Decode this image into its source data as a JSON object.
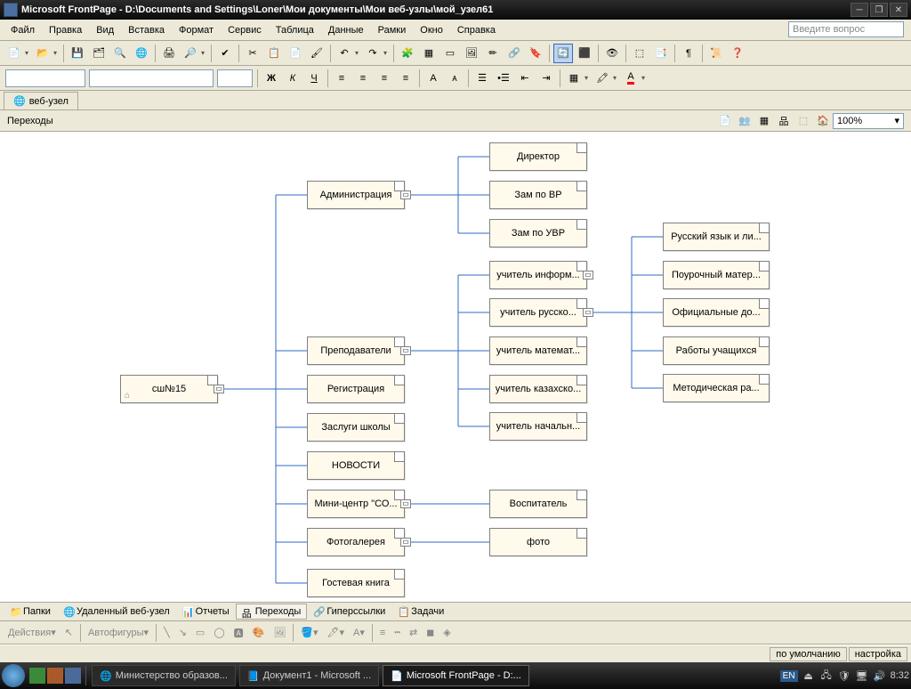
{
  "titlebar": {
    "app": "Microsoft FrontPage",
    "path": "D:\\Documents and Settings\\Loner\\Мои документы\\Мои веб-узлы\\мой_узел61"
  },
  "menus": [
    "Файл",
    "Правка",
    "Вид",
    "Вставка",
    "Формат",
    "Сервис",
    "Таблица",
    "Данные",
    "Рамки",
    "Окно",
    "Справка"
  ],
  "question_prompt": "Введите вопрос",
  "doc_tab": "веб-узел",
  "subheader_label": "Переходы",
  "zoom": "100%",
  "diagram": {
    "root": "сш№15",
    "level2": [
      "Администрация",
      "Преподаватели",
      "Регистрация",
      "Заслуги школы",
      "НОВОСТИ",
      "Мини-центр \"СО...",
      "Фотогалерея",
      "Гостевая книга"
    ],
    "admin_children": [
      "Директор",
      "Зам по ВР",
      "Зам по УВР"
    ],
    "teachers_children": [
      "учитель информ...",
      "учитель русско...",
      "учитель математ...",
      "учитель казахско...",
      "учитель начальн..."
    ],
    "russian_children": [
      "Русский язык и ли...",
      "Поурочный матер...",
      "Официальные до...",
      "Работы учащихся",
      "Методическая ра..."
    ],
    "minicenter_children": [
      "Воспитатель"
    ],
    "gallery_children": [
      "фото"
    ]
  },
  "bottom_tabs": [
    "Папки",
    "Удаленный веб-узел",
    "Отчеты",
    "Переходы",
    "Гиперссылки",
    "Задачи"
  ],
  "action_bar": {
    "actions": "Действия",
    "autoshapes": "Автофигуры"
  },
  "status": {
    "default": "по умолчанию",
    "custom": "настройка"
  },
  "taskbar": {
    "items": [
      "Министерство образов...",
      "Документ1 - Microsoft ...",
      "Microsoft FrontPage - D:..."
    ],
    "lang": "EN",
    "time": "8:32"
  }
}
